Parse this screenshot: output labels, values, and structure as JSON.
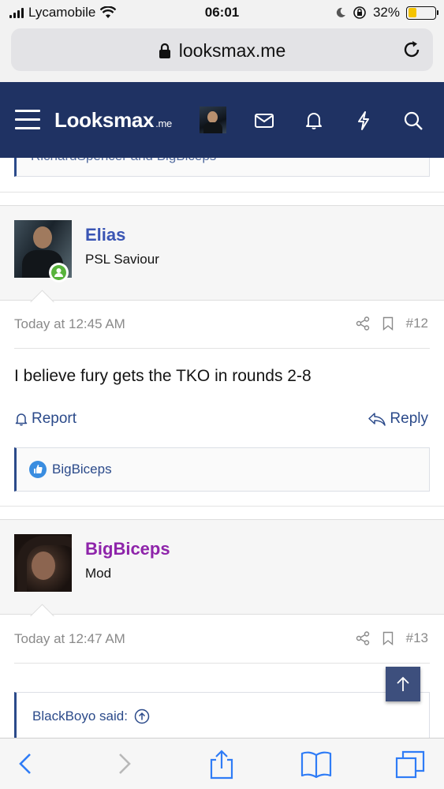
{
  "status_bar": {
    "carrier": "Lycamobile",
    "time": "06:01",
    "battery_percent": "32%",
    "battery_level": 0.32,
    "battery_color": "#f5c400"
  },
  "browser": {
    "url": "looksmax.me"
  },
  "header": {
    "logo_text": "Looksmax",
    "logo_suffix": ".me",
    "background": "#1f3263",
    "icons": [
      "menu-icon",
      "avatar",
      "mail-icon",
      "bell-icon",
      "lightning-icon",
      "search-icon"
    ]
  },
  "previous_post": {
    "reactions_text": "RichardSpencer and BigBiceps"
  },
  "posts": [
    {
      "username": "Elias",
      "username_color": "#3a55b4",
      "user_title": "PSL Saviour",
      "online": true,
      "time": "Today at 12:45 AM",
      "number": "#12",
      "message": "I believe fury gets the TKO in rounds 2-8",
      "report_label": "Report",
      "reply_label": "Reply",
      "reactions": "BigBiceps"
    },
    {
      "username": "BigBiceps",
      "username_color": "#8e24aa",
      "user_title": "Mod",
      "online": false,
      "time": "Today at 12:47 AM",
      "number": "#13",
      "quote_author": "BlackBoyo said:"
    }
  ]
}
